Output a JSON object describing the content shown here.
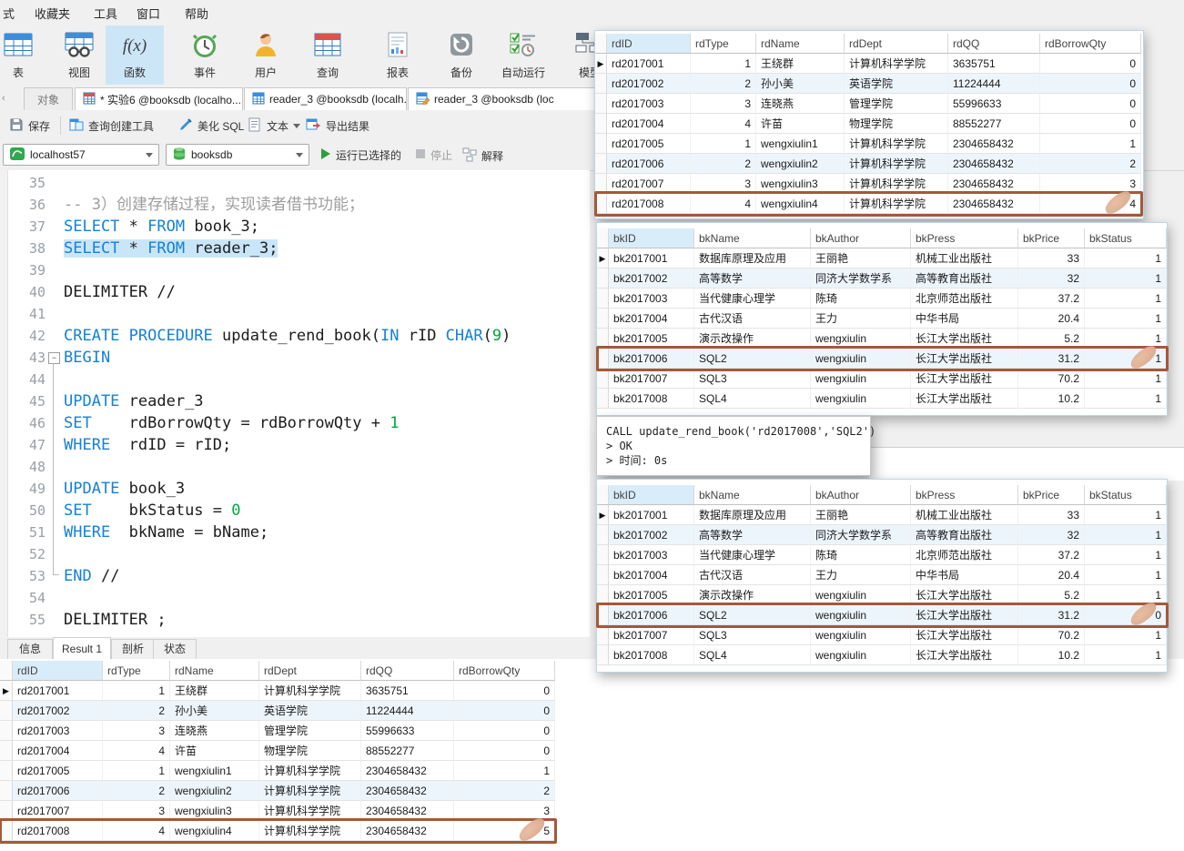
{
  "menubar": {
    "items": [
      "式",
      "收藏夹",
      "工具",
      "窗口",
      "帮助"
    ]
  },
  "toolbar": {
    "items": [
      {
        "id": "table",
        "label": "表",
        "selected": false
      },
      {
        "id": "view",
        "label": "视图",
        "selected": false
      },
      {
        "id": "function",
        "label": "函数",
        "selected": true
      },
      {
        "id": "event",
        "label": "事件",
        "selected": false
      },
      {
        "id": "user",
        "label": "用户",
        "selected": false
      },
      {
        "id": "query",
        "label": "查询",
        "selected": false
      },
      {
        "id": "report",
        "label": "报表",
        "selected": false
      },
      {
        "id": "backup",
        "label": "备份",
        "selected": false
      },
      {
        "id": "automation",
        "label": "自动运行",
        "selected": false
      },
      {
        "id": "model",
        "label": "模型",
        "selected": false
      }
    ]
  },
  "tabbar": {
    "tabs": [
      {
        "label": "对象",
        "icon": null,
        "muted": true
      },
      {
        "label": "* 实验6 @booksdb (localho...",
        "icon": "query-tab",
        "muted": false
      },
      {
        "label": "reader_3 @booksdb (localh...",
        "icon": "table-tab",
        "muted": false
      },
      {
        "label": "reader_3 @booksdb (loc",
        "icon": "edit-tab",
        "muted": false
      }
    ]
  },
  "query_toolbar": {
    "save": "保存",
    "builder": "查询创建工具",
    "beautify": "美化 SQL",
    "text": "文本",
    "export": "导出结果"
  },
  "connection_bar": {
    "connection": "localhost57",
    "database": "booksdb",
    "run": "运行已选择的",
    "stop": "停止",
    "explain": "解释"
  },
  "editor": {
    "lines": [
      {
        "no": 35,
        "segs": []
      },
      {
        "no": 36,
        "segs": [
          {
            "t": "-- 3）创建存储过程，实现读者借书功能；",
            "c": "cm"
          }
        ]
      },
      {
        "no": 37,
        "segs": [
          {
            "t": "SELECT",
            "c": "kw"
          },
          {
            "t": " * ",
            "c": "pl"
          },
          {
            "t": "FROM",
            "c": "kw"
          },
          {
            "t": " book_3;",
            "c": "pl"
          }
        ]
      },
      {
        "no": 38,
        "sel": true,
        "segs": [
          {
            "t": "SELECT",
            "c": "kw"
          },
          {
            "t": " * ",
            "c": "pl"
          },
          {
            "t": "FROM",
            "c": "kw"
          },
          {
            "t": " reader_3;",
            "c": "pl"
          }
        ]
      },
      {
        "no": 39,
        "segs": []
      },
      {
        "no": 40,
        "segs": [
          {
            "t": "DELIMITER //",
            "c": "pl"
          }
        ]
      },
      {
        "no": 41,
        "segs": []
      },
      {
        "no": 42,
        "segs": [
          {
            "t": "CREATE PROCEDURE",
            "c": "kw"
          },
          {
            "t": " update_rend_book(",
            "c": "pl"
          },
          {
            "t": "IN",
            "c": "kw"
          },
          {
            "t": " rID ",
            "c": "pl"
          },
          {
            "t": "CHAR",
            "c": "kw"
          },
          {
            "t": "(",
            "c": "pl"
          },
          {
            "t": "9",
            "c": "nm"
          },
          {
            "t": ")",
            "c": "pl"
          }
        ]
      },
      {
        "no": 43,
        "fold": "start",
        "segs": [
          {
            "t": "BEGIN",
            "c": "kw"
          }
        ]
      },
      {
        "no": 44,
        "segs": []
      },
      {
        "no": 45,
        "segs": [
          {
            "t": "UPDATE",
            "c": "kw"
          },
          {
            "t": " reader_3",
            "c": "pl"
          }
        ]
      },
      {
        "no": 46,
        "segs": [
          {
            "t": "SET",
            "c": "kw"
          },
          {
            "t": "    rdBorrowQty = rdBorrowQty + ",
            "c": "pl"
          },
          {
            "t": "1",
            "c": "nm"
          }
        ]
      },
      {
        "no": 47,
        "segs": [
          {
            "t": "WHERE",
            "c": "kw"
          },
          {
            "t": "  rdID = rID;",
            "c": "pl"
          }
        ]
      },
      {
        "no": 48,
        "segs": []
      },
      {
        "no": 49,
        "segs": [
          {
            "t": "UPDATE",
            "c": "kw"
          },
          {
            "t": " book_3",
            "c": "pl"
          }
        ]
      },
      {
        "no": 50,
        "segs": [
          {
            "t": "SET",
            "c": "kw"
          },
          {
            "t": "    bkStatus = ",
            "c": "pl"
          },
          {
            "t": "0",
            "c": "nm"
          }
        ]
      },
      {
        "no": 51,
        "segs": [
          {
            "t": "WHERE",
            "c": "kw"
          },
          {
            "t": "  bkName = bName;",
            "c": "pl"
          }
        ]
      },
      {
        "no": 52,
        "segs": []
      },
      {
        "no": 53,
        "fold": "end",
        "segs": [
          {
            "t": "END",
            "c": "kw"
          },
          {
            "t": " //",
            "c": "pl"
          }
        ]
      },
      {
        "no": 54,
        "segs": []
      },
      {
        "no": 55,
        "segs": [
          {
            "t": "DELIMITER ;",
            "c": "pl"
          }
        ]
      }
    ]
  },
  "result_tabs": [
    {
      "label": "信息",
      "active": false
    },
    {
      "label": "Result 1",
      "active": true
    },
    {
      "label": "剖析",
      "active": false
    },
    {
      "label": "状态",
      "active": false
    }
  ],
  "grids": {
    "reader_columns": [
      "rdID",
      "rdType",
      "rdName",
      "rdDept",
      "rdQQ",
      "rdBorrowQty"
    ],
    "book_columns": [
      "bkID",
      "bkName",
      "bkAuthor",
      "bkPress",
      "bkPrice",
      "bkStatus"
    ],
    "reader_rows_window": [
      [
        "rd2017001",
        "1",
        "王绕群",
        "计算机科学学院",
        "3635751",
        "0"
      ],
      [
        "rd2017002",
        "2",
        "孙小美",
        "英语学院",
        "11224444",
        "0"
      ],
      [
        "rd2017003",
        "3",
        "连晓燕",
        "管理学院",
        "55996633",
        "0"
      ],
      [
        "rd2017004",
        "4",
        "许苗",
        "物理学院",
        "88552277",
        "0"
      ],
      [
        "rd2017005",
        "1",
        "wengxiulin1",
        "计算机科学学院",
        "2304658432",
        "1"
      ],
      [
        "rd2017006",
        "2",
        "wengxiulin2",
        "计算机科学学院",
        "2304658432",
        "2"
      ],
      [
        "rd2017007",
        "3",
        "wengxiulin3",
        "计算机科学学院",
        "2304658432",
        "3"
      ],
      [
        "rd2017008",
        "4",
        "wengxiulin4",
        "计算机科学学院",
        "2304658432",
        "4"
      ]
    ],
    "reader_rows_bottom": [
      [
        "rd2017001",
        "1",
        "王绕群",
        "计算机科学学院",
        "3635751",
        "0"
      ],
      [
        "rd2017002",
        "2",
        "孙小美",
        "英语学院",
        "11224444",
        "0"
      ],
      [
        "rd2017003",
        "3",
        "连晓燕",
        "管理学院",
        "55996633",
        "0"
      ],
      [
        "rd2017004",
        "4",
        "许苗",
        "物理学院",
        "88552277",
        "0"
      ],
      [
        "rd2017005",
        "1",
        "wengxiulin1",
        "计算机科学学院",
        "2304658432",
        "1"
      ],
      [
        "rd2017006",
        "2",
        "wengxiulin2",
        "计算机科学学院",
        "2304658432",
        "2"
      ],
      [
        "rd2017007",
        "3",
        "wengxiulin3",
        "计算机科学学院",
        "2304658432",
        "3"
      ],
      [
        "rd2017008",
        "4",
        "wengxiulin4",
        "计算机科学学院",
        "2304658432",
        "5"
      ]
    ],
    "book_rows_before": [
      [
        "bk2017001",
        "数据库原理及应用",
        "王丽艳",
        "机械工业出版社",
        "33",
        "1"
      ],
      [
        "bk2017002",
        "高等数学",
        "同济大学数学系",
        "高等教育出版社",
        "32",
        "1"
      ],
      [
        "bk2017003",
        "当代健康心理学",
        "陈琦",
        "北京师范出版社",
        "37.2",
        "1"
      ],
      [
        "bk2017004",
        "古代汉语",
        "王力",
        "中华书局",
        "20.4",
        "1"
      ],
      [
        "bk2017005",
        "演示改操作",
        "wengxiulin",
        "长江大学出版社",
        "5.2",
        "1"
      ],
      [
        "bk2017006",
        "SQL2",
        "wengxiulin",
        "长江大学出版社",
        "31.2",
        "1"
      ],
      [
        "bk2017007",
        "SQL3",
        "wengxiulin",
        "长江大学出版社",
        "70.2",
        "1"
      ],
      [
        "bk2017008",
        "SQL4",
        "wengxiulin",
        "长江大学出版社",
        "10.2",
        "1"
      ]
    ],
    "book_rows_after": [
      [
        "bk2017001",
        "数据库原理及应用",
        "王丽艳",
        "机械工业出版社",
        "33",
        "1"
      ],
      [
        "bk2017002",
        "高等数学",
        "同济大学数学系",
        "高等教育出版社",
        "32",
        "1"
      ],
      [
        "bk2017003",
        "当代健康心理学",
        "陈琦",
        "北京师范出版社",
        "37.2",
        "1"
      ],
      [
        "bk2017004",
        "古代汉语",
        "王力",
        "中华书局",
        "20.4",
        "1"
      ],
      [
        "bk2017005",
        "演示改操作",
        "wengxiulin",
        "长江大学出版社",
        "5.2",
        "1"
      ],
      [
        "bk2017006",
        "SQL2",
        "wengxiulin",
        "长江大学出版社",
        "31.2",
        "0"
      ],
      [
        "bk2017007",
        "SQL3",
        "wengxiulin",
        "长江大学出版社",
        "70.2",
        "1"
      ],
      [
        "bk2017008",
        "SQL4",
        "wengxiulin",
        "长江大学出版社",
        "10.2",
        "1"
      ]
    ]
  },
  "call_output": {
    "lines": [
      "CALL update_rend_book('rd2017008','SQL2')",
      "> OK",
      "> 时间: 0s"
    ]
  },
  "colors": {
    "keyword": "#1581d8",
    "number": "#00a63f",
    "comment": "#9e9e9e",
    "selection": "#c9e6f8",
    "toolbar_selected": "#cde6f7",
    "header_selected": "#d9ecf9",
    "row_alt": "#edf5fc",
    "annotation": "#a3593a",
    "smudge": "#d7a484",
    "run_green": "#2f9e3f"
  }
}
